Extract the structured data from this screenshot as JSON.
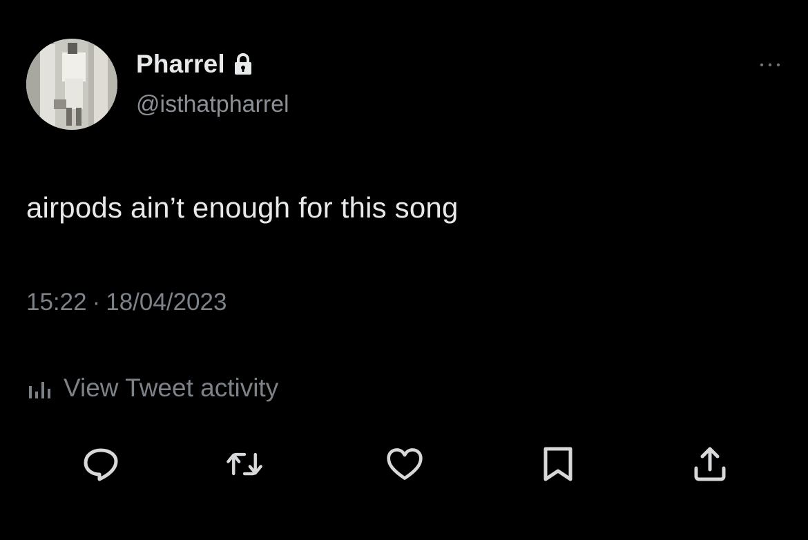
{
  "tweet": {
    "author": {
      "display_name": "Pharrel",
      "handle": "@isthatpharrel",
      "protected_icon": "lock-icon",
      "avatar": "profile-photo"
    },
    "more_icon": "more-horizontal-icon",
    "text": "airpods ain’t enough for this song",
    "time": "15:22",
    "separator": "·",
    "date": "18/04/2023",
    "activity": {
      "icon": "bar-chart-icon",
      "label": "View Tweet activity"
    },
    "actions": [
      {
        "name": "reply",
        "icon": "reply-icon"
      },
      {
        "name": "retweet",
        "icon": "retweet-icon"
      },
      {
        "name": "like",
        "icon": "heart-icon"
      },
      {
        "name": "bookmark",
        "icon": "bookmark-icon"
      },
      {
        "name": "share",
        "icon": "share-icon"
      }
    ]
  },
  "colors": {
    "background": "#000000",
    "primary_text": "#e7e9ea",
    "secondary_text": "#7d8288",
    "icon": "#d6d8da"
  }
}
